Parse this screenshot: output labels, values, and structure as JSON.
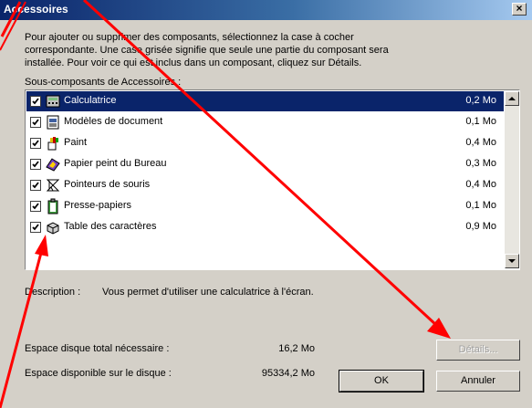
{
  "window": {
    "title": "Accessoires",
    "close_symbol": "×"
  },
  "intro": {
    "line1": "Pour ajouter ou supprimer des composants, sélectionnez la case à cocher",
    "line2": "correspondante. Une case grisée signifie que seule une partie du composant sera",
    "line3": "installée. Pour voir ce qui est inclus dans un composant, cliquez sur Détails."
  },
  "list_label": "Sous-composants de Accessoires :",
  "components": [
    {
      "name": "Calculatrice",
      "size": "0,2 Mo",
      "checked": true,
      "selected": true,
      "icon": "calculator-icon"
    },
    {
      "name": "Modèles de document",
      "size": "0,1 Mo",
      "checked": true,
      "selected": false,
      "icon": "document-icon"
    },
    {
      "name": "Paint",
      "size": "0,4 Mo",
      "checked": true,
      "selected": false,
      "icon": "paint-icon"
    },
    {
      "name": "Papier peint du Bureau",
      "size": "0,3 Mo",
      "checked": true,
      "selected": false,
      "icon": "wallpaper-icon"
    },
    {
      "name": "Pointeurs de souris",
      "size": "0,4 Mo",
      "checked": true,
      "selected": false,
      "icon": "mouse-pointer-icon"
    },
    {
      "name": "Presse-papiers",
      "size": "0,1 Mo",
      "checked": true,
      "selected": false,
      "icon": "clipboard-icon"
    },
    {
      "name": "Table des caractères",
      "size": "0,9 Mo",
      "checked": true,
      "selected": false,
      "icon": "character-map-icon"
    }
  ],
  "description": {
    "label": "Description :",
    "text": "Vous permet d'utiliser une calculatrice à l'écran."
  },
  "disk": {
    "required_label": "Espace disque total nécessaire :",
    "required_value": "16,2 Mo",
    "available_label": "Espace disponible sur le disque :",
    "available_value": "95334,2 Mo"
  },
  "buttons": {
    "details": "Détails...",
    "ok": "OK",
    "cancel": "Annuler"
  },
  "colors": {
    "titlebar": "#0a246a",
    "face": "#d4d0c8",
    "selection": "#0a246a",
    "arrow": "#ff0000"
  }
}
